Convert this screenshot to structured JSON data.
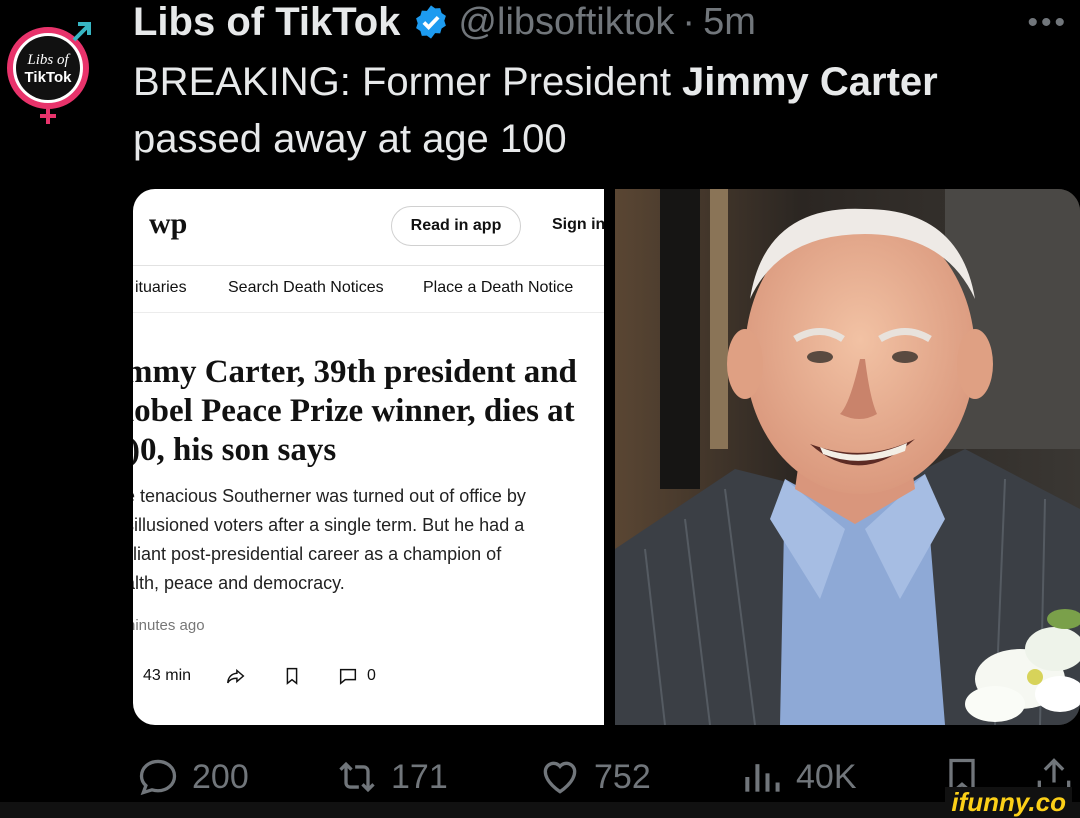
{
  "post": {
    "display_name": "Libs of TikTok",
    "handle": "@libsoftiktok",
    "separator": "·",
    "time": "5m",
    "text_before": "BREAKING: Former President ",
    "text_bold": "Jimmy Carter",
    "text_after": " passed away at age 100",
    "avatar_text_line1": "Libs of",
    "avatar_text_line2": "TikTok"
  },
  "article": {
    "logo": "wp",
    "read_in_app": "Read in app",
    "sign_in": "Sign in",
    "nav": [
      "ituaries",
      "Search Death Notices",
      "Place a Death Notice"
    ],
    "headline_lines": [
      "mmy Carter, 39th president and",
      "lobel Peace Prize winner, dies at",
      ")0, his son says"
    ],
    "dek_lines": [
      "e tenacious Southerner was turned out of office by",
      "sillusioned voters after a single term. But he had a",
      "illiant post-presidential career as a champion of",
      "alth, peace and democracy."
    ],
    "time_ago": "ninutes ago",
    "read_time": "43 min",
    "comments": "0"
  },
  "engagement": {
    "replies": "200",
    "reposts": "171",
    "likes": "752",
    "views": "40K"
  },
  "watermark": "ifunny.co",
  "colors": {
    "verified": "#1d9bf0",
    "muted": "#71767b",
    "watermark": "#fcd018"
  }
}
